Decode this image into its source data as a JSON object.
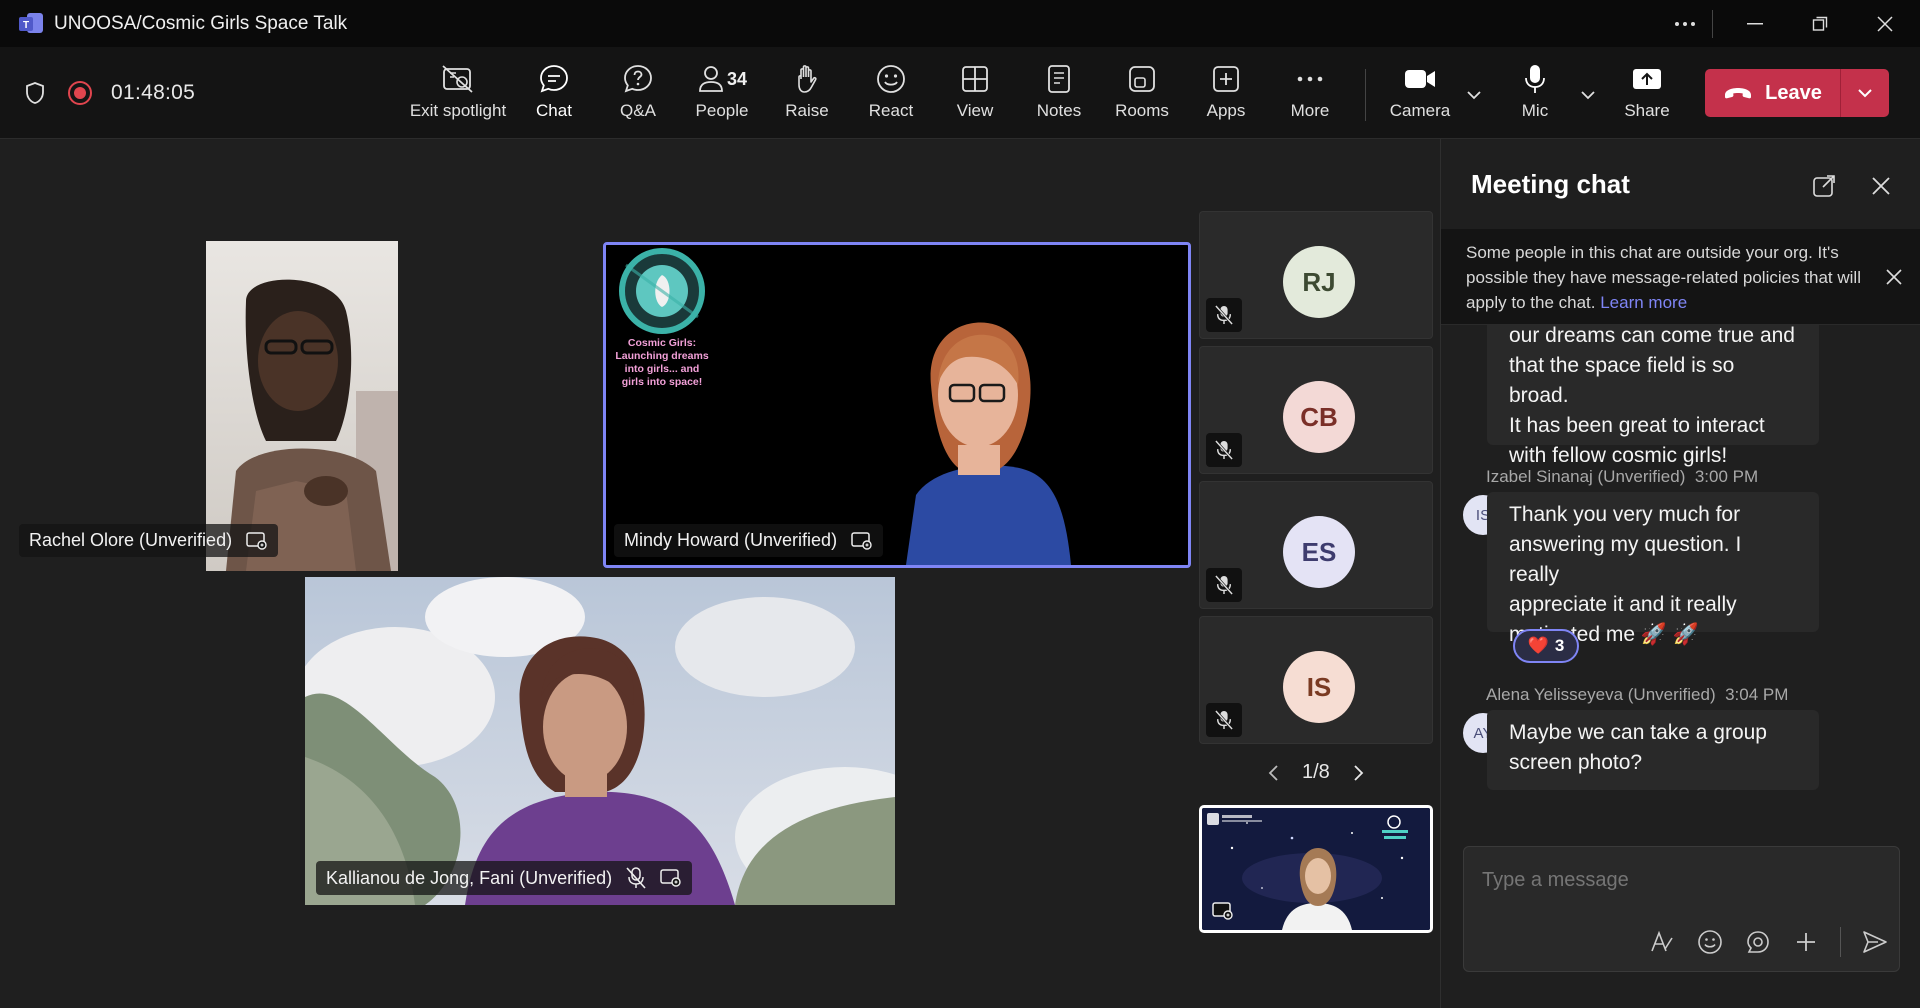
{
  "window": {
    "title": "UNOOSA/Cosmic Girls Space Talk"
  },
  "toolbar": {
    "timer": "01:48:05",
    "buttons": {
      "exit_spotlight": "Exit spotlight",
      "chat": "Chat",
      "qa": "Q&A",
      "people": "People",
      "people_count": "34",
      "raise": "Raise",
      "react": "React",
      "view": "View",
      "notes": "Notes",
      "rooms": "Rooms",
      "apps": "Apps",
      "more": "More",
      "camera": "Camera",
      "mic": "Mic",
      "share": "Share",
      "leave": "Leave"
    },
    "accent_color": "#7f85f5",
    "leave_color": "#c4314b"
  },
  "stage": {
    "tiles": [
      {
        "name": "Rachel Olore (Unverified)"
      },
      {
        "name": "Mindy Howard (Unverified)",
        "banner_text": "Cosmic Girls: Launching dreams into girls... and girls into space!"
      },
      {
        "name": "Kallianou de Jong, Fani (Unverified)"
      }
    ],
    "roster": [
      {
        "initials": "RJ",
        "bg": "#e3eadb",
        "fg": "#3d4a32"
      },
      {
        "initials": "CB",
        "bg": "#f3d9d6",
        "fg": "#7a2f28"
      },
      {
        "initials": "ES",
        "bg": "#e4e3f5",
        "fg": "#3e3c6e"
      },
      {
        "initials": "IS",
        "bg": "#f6ddd3",
        "fg": "#7a3a22"
      }
    ],
    "pager": "1/8"
  },
  "chat": {
    "title": "Meeting chat",
    "banner": {
      "text": "Some people in this chat are outside your org. It's possible they have message-related policies that will apply to the chat.",
      "link": "Learn more"
    },
    "messages": [
      {
        "lines": [
          "our dreams can come true and",
          "that the space field is so broad.",
          "It has been great to interact",
          "with fellow cosmic girls!"
        ]
      },
      {
        "author": "Izabel Sinanaj (Unverified)",
        "time": "3:00 PM",
        "initials": "IS",
        "lines": [
          "Thank you very much for",
          "answering my question. I really",
          "appreciate it and it really",
          "motivated me 🚀 🚀"
        ],
        "reaction": {
          "emoji": "❤️",
          "count": "3"
        }
      },
      {
        "author": "Alena Yelisseyeva (Unverified)",
        "time": "3:04 PM",
        "initials": "AY",
        "lines": [
          "Maybe we can take a group",
          "screen photo?"
        ]
      }
    ],
    "composer": {
      "placeholder": "Type a message"
    }
  }
}
